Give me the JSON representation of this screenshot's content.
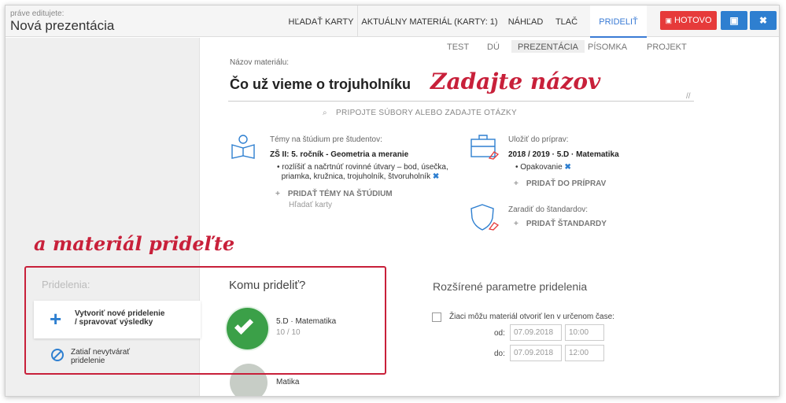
{
  "header": {
    "editing_label": "práve editujete:",
    "doc_title": "Nová prezentácia",
    "nav": [
      "HĽADAŤ KARTY",
      "AKTUÁLNY MATERIÁL (KARTY: 1)",
      "NÁHĽAD",
      "TLAČ",
      "PRIDELIŤ"
    ],
    "done_label": "HOTOVO",
    "save_icon": "save-icon",
    "close_icon": "close-icon"
  },
  "content_tabs": [
    "TEST",
    "DÚ",
    "PREZENTÁCIA",
    "PÍSOMKA",
    "PROJEKT"
  ],
  "material": {
    "label": "Názov materiálu:",
    "title": "Čo už vieme o trojuholníku",
    "attach_label": "PRIPOJTE SÚBORY ALEBO ZADAJTE OTÁZKY"
  },
  "annotations": {
    "enter_name": "Zadajte názov",
    "assign_material": "a materiál prideľte"
  },
  "topics": {
    "label": "Témy na štúdium pre študentov:",
    "subject": "ZŠ II: 5. ročník - Geometria a meranie",
    "item_line1": "rozlíšiť a načrtnúť rovinné útvary – bod, úsečka,",
    "item_line2": "priamka, kružnica, trojuholník, štvoruholník",
    "add_label": "PRIDAŤ TÉMY NA ŠTÚDIUM",
    "search_label": "Hľadať karty"
  },
  "preparations": {
    "label": "Uložiť do príprav:",
    "value": "2018 / 2019 · 5.D · Matematika",
    "item": "Opakovanie",
    "add_label": "PRIDAŤ DO PRÍPRAV"
  },
  "standards": {
    "label": "Zaradiť do štandardov:",
    "add_label": "PRIDAŤ ŠTANDARDY"
  },
  "assignments": {
    "heading": "Pridelenia:",
    "create_line1": "Vytvoriť nové pridelenie",
    "create_line2": "/ spravovať výsledky",
    "skip_line1": "Zatiaľ nevytvárať",
    "skip_line2": "pridelenie"
  },
  "assign_to": {
    "heading": "Komu prideliť?",
    "class1_name": "5.D · Matematika",
    "class1_count": "10 / 10",
    "class2_name": "Matika"
  },
  "extended": {
    "heading": "Rozšírené parametre pridelenia",
    "checkbox_label": "Žiaci môžu materiál otvoriť len v určenom čase:",
    "from_label": "od:",
    "from_date": "07.09.2018",
    "from_time": "10:00",
    "to_label": "do:",
    "to_date": "07.09.2018",
    "to_time": "12:00"
  },
  "colors": {
    "accent": "#2e7fd0",
    "danger": "#e63a3a",
    "annotation": "#c8203a",
    "success": "#3ba048"
  }
}
